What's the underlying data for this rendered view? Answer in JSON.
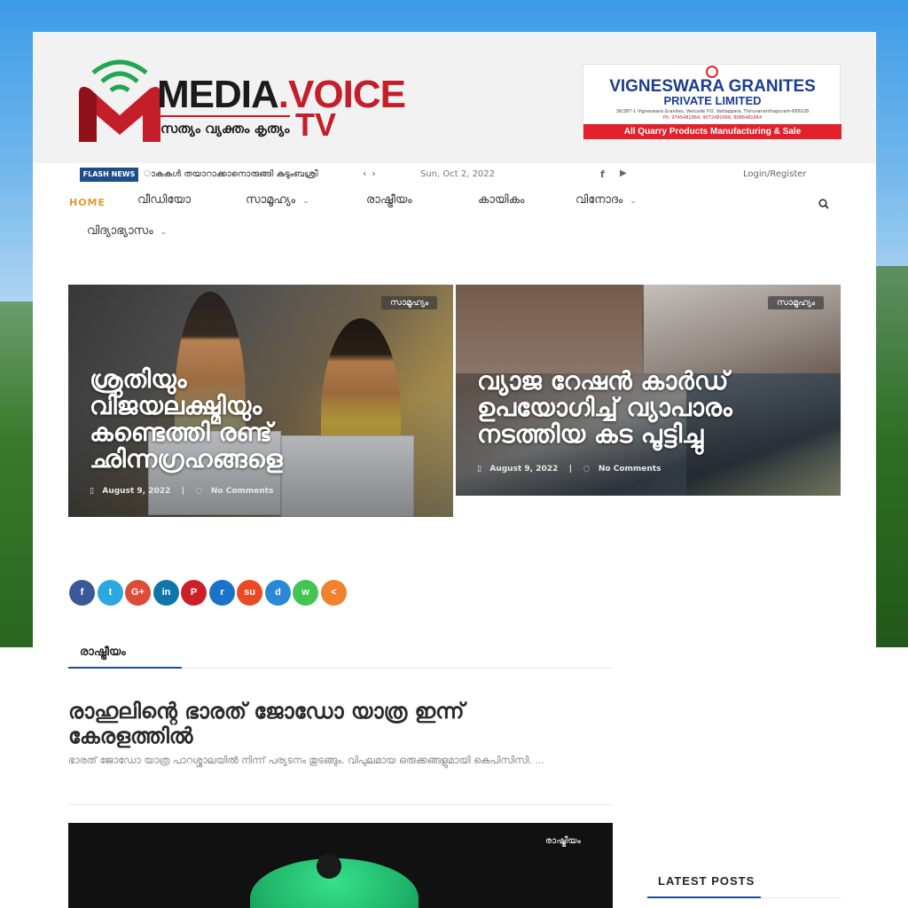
{
  "logo": {
    "name_part1": "MEDIA",
    "name_dot": ".",
    "name_part2": "VOICE",
    "tv": "TV",
    "tagline": "സത്യം വ്യക്തം കൃത്യം"
  },
  "ad": {
    "name": "VIGNESWARA GRANITES",
    "sub": "PRIVATE LIMITED",
    "address": "36/387-1 Vigneswara Granites, Vencode P.O, Vattappara, Thiruvananthapuram-695028",
    "phone": "Ph: 9745481664, 9072481666, 8086481664",
    "tagline": "All Quarry Products Manufacturing & Sale"
  },
  "topbar": {
    "flash_label": "FLASH NEWS",
    "flash_text": "ാകകൾ തയാറാക്കാനൊരുങ്ങി കുടുംബശ്രീ",
    "prev": "‹",
    "next": "›",
    "date": "Sun, Oct 2, 2022",
    "login": "Login/Register"
  },
  "nav": {
    "items": [
      {
        "label": "HOME"
      },
      {
        "label": "വീഡിയോ"
      },
      {
        "label": "സാമൂഹ്യം"
      },
      {
        "label": "രാഷ്ട്രീയം"
      },
      {
        "label": "കായികം"
      },
      {
        "label": "വിനോദം"
      },
      {
        "label": "വിദ്യാഭ്യാസം"
      }
    ]
  },
  "featured": [
    {
      "category": "സാമൂഹ്യം",
      "title": "ശ്രുതിയും വിജയലക്ഷ്മിയും കണ്ടെത്തി രണ്ട് ഛിന്നഗ്രഹങ്ങളെ",
      "date": "August 9, 2022",
      "comments": "No Comments"
    },
    {
      "category": "സാമൂഹ്യം",
      "title": "വ്യാജ റേഷൻ കാർഡ് ഉപയോഗിച്ച് വ്യാപാരം നടത്തിയ കട പൂട്ടിച്ചു",
      "date": "August 9, 2022",
      "comments": "No Comments"
    }
  ],
  "share": [
    "f",
    "t",
    "G+",
    "in",
    "P",
    "r",
    "su",
    "d",
    "w",
    "<"
  ],
  "section": {
    "tab": "രാഷ്ട്രീയം"
  },
  "article": {
    "title": "രാഹുലിന്റെ ഭാരത് ജോഡോ യാത്ര ഇന്ന് കേരളത്തിൽ",
    "excerpt": "ഭാരത് ജോഡോ യാത്ര പാറശ്ശാലയിൽ നിന്ന് പര്യടനം തുടങ്ങും. വിപുലമായ ഒരുക്കങ്ങളുമായി കെപിസിസി. ...",
    "category": "രാഷ്ട്രീയം"
  },
  "sidebar": {
    "latest_title": "LATEST POSTS"
  },
  "colors": {
    "brand_red": "#c41e2b",
    "brand_blue": "#1d4e89",
    "home_active": "#e19c35"
  }
}
